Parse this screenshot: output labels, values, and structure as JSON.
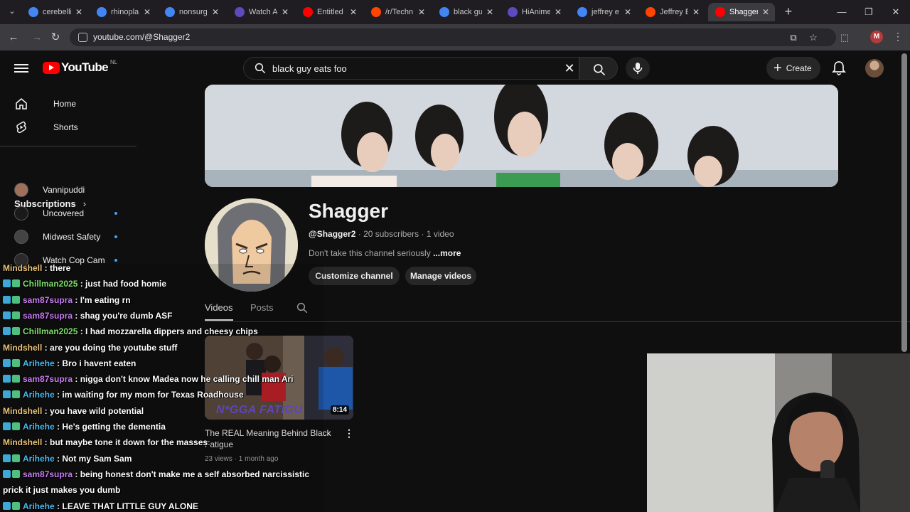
{
  "browser": {
    "tabs": [
      {
        "title": "cerebelli",
        "icon": "google-icon",
        "color": "#4285f4"
      },
      {
        "title": "rhinopla",
        "icon": "google-icon",
        "color": "#4285f4"
      },
      {
        "title": "nonsurg",
        "icon": "google-icon",
        "color": "#4285f4"
      },
      {
        "title": "Watch A",
        "icon": "hianime-icon",
        "color": "#5b4bbd"
      },
      {
        "title": "Entitled",
        "icon": "youtube-icon",
        "color": "#ff0000"
      },
      {
        "title": "/r/Techn",
        "icon": "reddit-icon",
        "color": "#ff4500"
      },
      {
        "title": "black gu",
        "icon": "google-icon",
        "color": "#4285f4"
      },
      {
        "title": "HiAnime",
        "icon": "hianime-icon",
        "color": "#5b4bbd"
      },
      {
        "title": "jeffrey e",
        "icon": "google-icon",
        "color": "#4285f4"
      },
      {
        "title": "Jeffrey E",
        "icon": "reddit-icon",
        "color": "#ff4500"
      },
      {
        "title": "Shagger",
        "icon": "youtube-icon",
        "color": "#ff0000"
      }
    ],
    "url": "youtube.com/@Shagger2",
    "profile_initial": "M"
  },
  "youtube": {
    "logo_text": "YouTube",
    "country_code": "NL",
    "search_value": "black guy eats foo",
    "create_label": "Create",
    "sidebar": {
      "items": [
        {
          "label": "Home",
          "icon": "home-icon"
        },
        {
          "label": "Shorts",
          "icon": "shorts-icon"
        }
      ],
      "subscriptions_title": "Subscriptions",
      "subscriptions": [
        {
          "name": "Vannipuddi",
          "color": "#a0715a",
          "new": false
        },
        {
          "name": "Uncovered",
          "color": "#1a1a1a",
          "new": true
        },
        {
          "name": "Midwest Safety",
          "color": "#444444",
          "new": true
        },
        {
          "name": "Watch Cop Cam",
          "color": "#2a2a2a",
          "new": true
        }
      ]
    },
    "channel": {
      "name": "Shagger",
      "handle": "@Shagger2",
      "subscribers": "20 subscribers",
      "videos_count": "1 video",
      "description": "Don't take this channel seriously",
      "more_label": "...more",
      "customize_label": "Customize channel",
      "manage_label": "Manage videos",
      "tabs": [
        "Videos",
        "Posts"
      ]
    },
    "video": {
      "title": "The REAL Meaning Behind Black Fatigue",
      "duration": "8:14",
      "views": "23 views",
      "age": "1 month ago",
      "thumb_caption": "N*GGA FATIGU"
    }
  },
  "chat": {
    "messages": [
      {
        "user": "Mindshell",
        "text": "there",
        "color": "orange",
        "badge": false
      },
      {
        "user": "Chillman2025",
        "text": "just had food homie",
        "color": "green",
        "badge": true
      },
      {
        "user": "sam87supra",
        "text": "I'm eating rn",
        "color": "purple",
        "badge": true
      },
      {
        "user": "sam87supra",
        "text": "shag you're dumb ASF",
        "color": "purple",
        "badge": true
      },
      {
        "user": "Chillman2025",
        "text": "I had mozzarella dippers and cheesy chips",
        "color": "green",
        "badge": true
      },
      {
        "user": "Mindshell",
        "text": "are you doing the youtube stuff",
        "color": "orange",
        "badge": false
      },
      {
        "user": "Arihehe",
        "text": "Bro i havent eaten",
        "color": "blue",
        "badge": true
      },
      {
        "user": "sam87supra",
        "text": "nigga don't know Madea now he calling chill man Ari",
        "color": "purple",
        "badge": true
      },
      {
        "user": "Arihehe",
        "text": "im waiting for my mom for Texas Roadhouse",
        "color": "blue",
        "badge": true
      },
      {
        "user": "Mindshell",
        "text": "you have wild potential",
        "color": "orange",
        "badge": false
      },
      {
        "user": "Arihehe",
        "text": "He's getting the dementia",
        "color": "blue",
        "badge": true
      },
      {
        "user": "Mindshell",
        "text": "but maybe tone it down for the masses",
        "color": "orange",
        "badge": false
      },
      {
        "user": "Arihehe",
        "text": "Not my Sam Sam",
        "color": "blue",
        "badge": true
      },
      {
        "user": "sam87supra",
        "text": "being honest don't make me a self absorbed narcissistic",
        "color": "purple",
        "badge": true
      },
      {
        "user": "",
        "text": "prick it just makes you dumb",
        "color": "white",
        "badge": false
      },
      {
        "user": "Arihehe",
        "text": "LEAVE THAT LITTLE GUY ALONE",
        "color": "blue",
        "badge": true
      }
    ]
  }
}
